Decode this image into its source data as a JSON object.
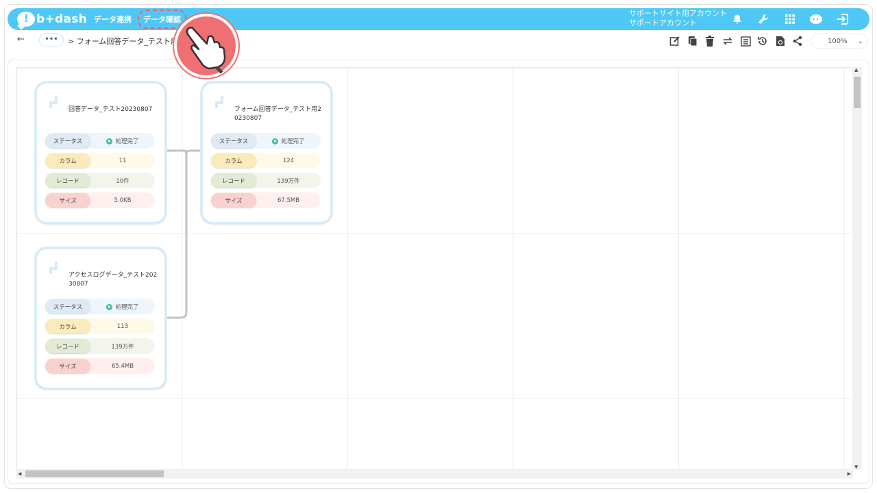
{
  "app": {
    "logo_text": "b+dash",
    "logo_mark": "!"
  },
  "nav": {
    "items": [
      {
        "label": "データ連携"
      },
      {
        "label": "データ確認"
      }
    ],
    "account_line1": "サポートサイト用アカウント",
    "account_line2": "サポートアカウント"
  },
  "toolbar": {
    "back_icon": "←",
    "more_label": "•••",
    "breadcrumb": "> フォーム回答データ_テスト用",
    "zoom": "100%",
    "zoom_chevron": "⌄"
  },
  "cards": [
    {
      "title": "回答データ_テスト20230807",
      "status_label": "ステータス",
      "status_value": "処理完了",
      "column_label": "カラム",
      "column_value": "11",
      "record_label": "レコード",
      "record_value": "10件",
      "size_label": "サイズ",
      "size_value": "5.0KB"
    },
    {
      "title": "フォーム回答データ_テスト用20230807",
      "status_label": "ステータス",
      "status_value": "処理完了",
      "column_label": "カラム",
      "column_value": "124",
      "record_label": "レコード",
      "record_value": "139万件",
      "size_label": "サイズ",
      "size_value": "67.5MB"
    },
    {
      "title": "アクセスログデータ_テスト20230807",
      "status_label": "ステータス",
      "status_value": "処理完了",
      "column_label": "カラム",
      "column_value": "113",
      "record_label": "レコード",
      "record_value": "139万件",
      "size_label": "サイズ",
      "size_value": "65.4MB"
    }
  ],
  "colors": {
    "nav_bg": "#4fc8f5",
    "status_ok": "#3cbf9a",
    "highlight": "#f06f73"
  }
}
